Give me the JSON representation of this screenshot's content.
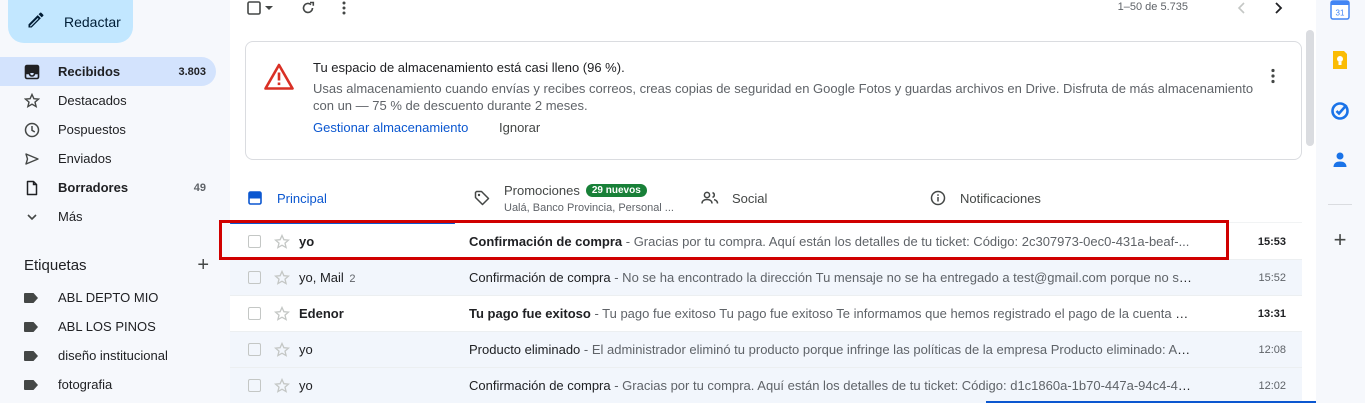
{
  "compose": {
    "label": "Redactar"
  },
  "nav": {
    "items": [
      {
        "label": "Recibidos",
        "count": "3.803"
      },
      {
        "label": "Destacados",
        "count": ""
      },
      {
        "label": "Pospuestos",
        "count": ""
      },
      {
        "label": "Enviados",
        "count": ""
      },
      {
        "label": "Borradores",
        "count": "49"
      },
      {
        "label": "Más",
        "count": ""
      }
    ]
  },
  "labels": {
    "title": "Etiquetas",
    "add": "+",
    "items": [
      {
        "label": "ABL DEPTO MIO"
      },
      {
        "label": "ABL LOS PINOS"
      },
      {
        "label": "diseño institucional"
      },
      {
        "label": "fotografia"
      }
    ]
  },
  "toolbar": {
    "range": "1–50 de 5.735"
  },
  "banner": {
    "title": "Tu espacio de almacenamiento está casi lleno (96 %).",
    "description": "Usas almacenamiento cuando envías y recibes correos, creas copias de seguridad en Google Fotos y guardas archivos en Drive. Disfruta de más almacenamiento con un — 75 % de descuento durante 2 meses.",
    "manage": "Gestionar almacenamiento",
    "ignore": "Ignorar"
  },
  "tabs": {
    "primary": "Principal",
    "promotions": "Promociones",
    "promotions_badge": "29 nuevos",
    "promotions_sub": "Ualá, Banco Provincia, Personal ...",
    "social": "Social",
    "notifications": "Notificaciones"
  },
  "emails": [
    {
      "sender": "yo",
      "count": "",
      "subject": "Confirmación de compra",
      "snippet": " - Gracias por tu compra. Aquí están los detalles de tu ticket: Código: 2c307973-0ec0-431a-beaf-...",
      "time": "15:53",
      "unread": true
    },
    {
      "sender": "yo, Mail",
      "count": "2",
      "subject": "Confirmación de compra",
      "snippet": " - No se ha encontrado la dirección Tu mensaje no se ha entregado a test@gmail.com porque no se ...",
      "time": "15:52",
      "unread": false
    },
    {
      "sender": "Edenor",
      "count": "",
      "subject": "Tu pago fue exitoso",
      "snippet": " - Tu pago fue exitoso Tu pago fue exitoso Te informamos que hemos registrado el pago de la cuenta 75...",
      "time": "13:31",
      "unread": true
    },
    {
      "sender": "yo",
      "count": "",
      "subject": "Producto eliminado",
      "snippet": " - El administrador eliminó tu producto porque infringe las políticas de la empresa Producto eliminado: Ac...",
      "time": "12:08",
      "unread": false
    },
    {
      "sender": "yo",
      "count": "",
      "subject": "Confirmación de compra",
      "snippet": " - Gracias por tu compra. Aquí están los detalles de tu ticket: Código: d1c1860a-1b70-447a-94c4-44...",
      "time": "12:02",
      "unread": false
    }
  ],
  "side_panel": {
    "calendar_day": "31",
    "add": "+"
  },
  "colors": {
    "accent": "#0b57d0",
    "compose_bg": "#c2e7ff",
    "active_nav": "#d3e3fd",
    "badge": "#188038",
    "highlight": "#d00000",
    "warning": "#d93025"
  }
}
